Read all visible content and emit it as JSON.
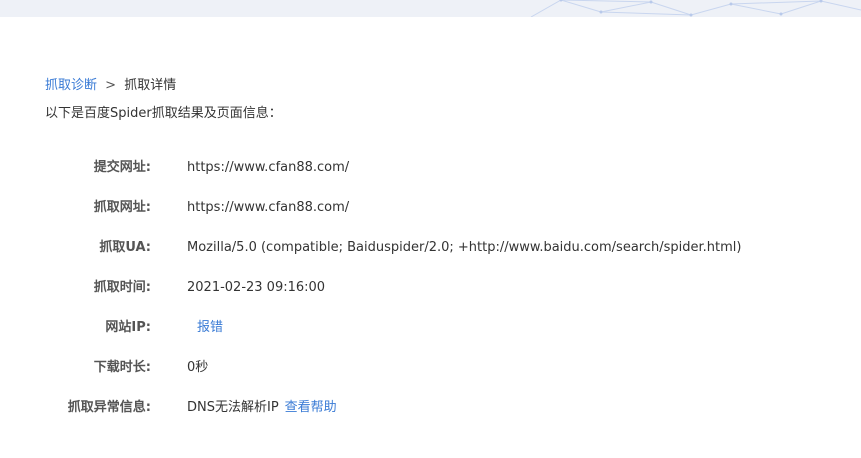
{
  "breadcrumb": {
    "parent": "抓取诊断",
    "separator": ">",
    "current": "抓取详情"
  },
  "subtitle": "以下是百度Spider抓取结果及页面信息：",
  "rows": {
    "submit_url": {
      "label": "提交网址:",
      "value": "https://www.cfan88.com/"
    },
    "crawl_url": {
      "label": "抓取网址:",
      "value": "https://www.cfan88.com/"
    },
    "crawl_ua": {
      "label": "抓取UA:",
      "value": "Mozilla/5.0 (compatible; Baiduspider/2.0; +http://www.baidu.com/search/spider.html)"
    },
    "crawl_time": {
      "label": "抓取时间:",
      "value": "2021-02-23 09:16:00"
    },
    "site_ip": {
      "label": "网站IP:",
      "value": "",
      "report_link": "报错"
    },
    "download_time": {
      "label": "下载时长:",
      "value": "0秒"
    },
    "crawl_error": {
      "label": "抓取异常信息:",
      "value": "DNS无法解析IP",
      "help_link": "查看帮助"
    }
  },
  "colors": {
    "link": "#3a7bd5",
    "label": "#555555",
    "text": "#333333",
    "banner": "#eef1f7"
  }
}
